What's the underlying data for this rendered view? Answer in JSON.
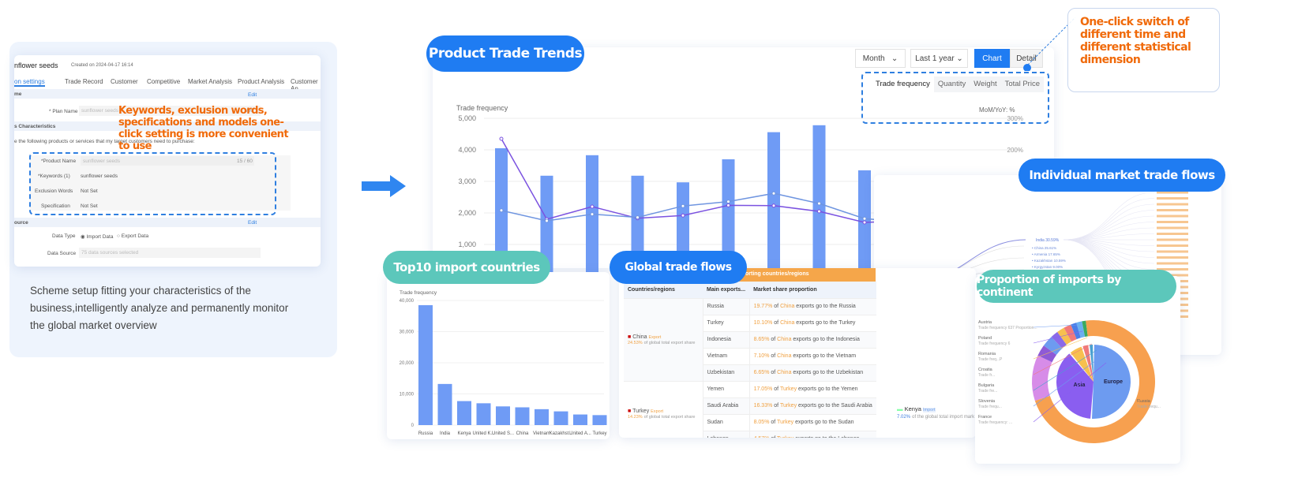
{
  "setup": {
    "title": "nflower seeds",
    "created": "Created on 2024-04-17 16:14",
    "tabs": [
      "on settings",
      "Trade Record",
      "Customer",
      "Competitive",
      "Market Analysis",
      "Product Analysis",
      "Customer An"
    ],
    "section1": "me",
    "edit": "Edit",
    "plan_name_label": "* Plan Name",
    "plan_name_value": "sunflower seeds",
    "plan_count": "/50",
    "section2": "s Characteristics",
    "prompt": "e the following products or services that my target customers need to purchase:",
    "product_name_label": "*Product Name",
    "product_name_value": "sunflower seeds",
    "product_count": "15 / 60",
    "keywords_label": "*Keywords (1)",
    "keywords_value": "sunflower seeds",
    "exclusion_label": "Exclusion Words",
    "exclusion_value": "Not Set",
    "spec_label": "Specification",
    "spec_value": "Not Set",
    "section3": "ource",
    "data_type_label": "Data Type",
    "import_label": "Import Data",
    "export_label": "Export Data",
    "data_source_label": "Data Source",
    "data_source_value": "75 data sources selected",
    "callout": "Keywords, exclusion words, specifications and models one-click setting is more convenient to use",
    "description": "Scheme setup fitting your characteristics of the business,intelligently analyze and permanently monitor the global market overview"
  },
  "trends": {
    "pill": "Product Trade Trends",
    "period": "Month",
    "range": "Last 1 year",
    "chart_btn": "Chart",
    "detail_btn": "Detail",
    "metrics": [
      "Trade frequency",
      "Quantity",
      "Weight",
      "Total Price"
    ],
    "mom": "MoM/YoY: %",
    "callout": "One-click switch of different time and different statistical dimension"
  },
  "chart_data": [
    {
      "type": "bar",
      "title": "",
      "ylabel": "Trade frequency",
      "ylim": [
        0,
        5000
      ],
      "yticks": [
        "5,000",
        "4,000",
        "3,000",
        "2,000",
        "1,000"
      ],
      "y2ticks": [
        "300%",
        "200%"
      ],
      "values": [
        4050,
        3180,
        3830,
        3180,
        2970,
        3700,
        4560,
        4780,
        3350
      ],
      "lines": [
        {
          "color": "#7b52e0",
          "values": [
            4350,
            1800,
            2200,
            1830,
            1920,
            2240,
            2230,
            2050,
            1700,
            1750
          ]
        },
        {
          "color": "#6f95e0",
          "values": [
            2080,
            1750,
            1960,
            1860,
            2220,
            2360,
            2620,
            2300,
            1820,
            1700
          ]
        }
      ]
    },
    {
      "type": "bar",
      "title": "Top10 import countries",
      "ylabel": "Trade frequency",
      "ylim": [
        0,
        40000
      ],
      "yticks": [
        "40,000",
        "30,000",
        "20,000",
        "10,000",
        "0"
      ],
      "categories": [
        "Russia",
        "India",
        "Kenya",
        "United K...",
        "United S...",
        "China",
        "Vietnam",
        "Kazakhst...",
        "United A...",
        "Turkey"
      ],
      "values": [
        38500,
        13200,
        7700,
        7000,
        6000,
        5700,
        5100,
        4400,
        3400,
        3200
      ]
    },
    {
      "type": "pie",
      "title": "Proportion of imports by continent",
      "inner": [
        {
          "name": "Europe",
          "value": 51
        },
        {
          "name": "Asia",
          "value": 38
        },
        {
          "name": "",
          "value": 6
        },
        {
          "name": "",
          "value": 3
        },
        {
          "name": "",
          "value": 2
        }
      ],
      "outer_labels": [
        {
          "name": "Austria",
          "sub": "Trade frequency 637 Proportion..."
        },
        {
          "name": "Poland",
          "sub": "Trade frequency 6"
        },
        {
          "name": "Romania",
          "sub": "Trade freq...P"
        },
        {
          "name": "Croatia",
          "sub": "Trade fr..."
        },
        {
          "name": "Bulgaria",
          "sub": "Trade fre..."
        },
        {
          "name": "Slovenia",
          "sub": "Trade frequ..."
        },
        {
          "name": "France",
          "sub": "Trade frequency: ..."
        },
        {
          "name": "Russia",
          "sub": "Trade frequ..."
        }
      ]
    }
  ],
  "flows": {
    "pill": "Global trade flows",
    "group_header": "orting countries/regions",
    "headers": [
      "Countries/regions",
      "Main exports...",
      "Market share proportion"
    ],
    "exporters": [
      {
        "name": "China",
        "badge": "Export",
        "share": "24.53%",
        "share_text": "of global total export share"
      },
      {
        "name": "Turkey",
        "badge": "Export",
        "share": "14.23%",
        "share_text": "of global total export share"
      }
    ],
    "rows": [
      {
        "country": "Russia",
        "pct": "19.77%",
        "src": "China"
      },
      {
        "country": "Turkey",
        "pct": "10.10%",
        "src": "China"
      },
      {
        "country": "Indonesia",
        "pct": "8.65%",
        "src": "China"
      },
      {
        "country": "Vietnam",
        "pct": "7.10%",
        "src": "China"
      },
      {
        "country": "Uzbekistan",
        "pct": "6.65%",
        "src": "China"
      },
      {
        "country": "Yemen",
        "pct": "17.05%",
        "src": "Turkey"
      },
      {
        "country": "Saudi Arabia",
        "pct": "16.33%",
        "src": "Turkey"
      },
      {
        "country": "Sudan",
        "pct": "8.05%",
        "src": "Turkey"
      },
      {
        "country": "Lebanon",
        "pct": "4.57%",
        "src": "Turkey"
      }
    ],
    "kenya": {
      "name": "Kenya",
      "badge": "Import",
      "share": "7.02%",
      "text": "of the global total import mark"
    }
  },
  "tree": {
    "pill": "Individual market trade flows",
    "root": "Russia(Export)",
    "hub": "India 30.59%",
    "children": [
      "China 25.61%",
      "Armenia 17.65%",
      "Kazakhstan 10.59%",
      "Kyrgyzstan 9.00%"
    ]
  },
  "colors": {
    "accent": "#1f7cf2",
    "teal": "#5cc7bb",
    "orange": "#f06a0a",
    "bar": "#6f9bf5"
  }
}
